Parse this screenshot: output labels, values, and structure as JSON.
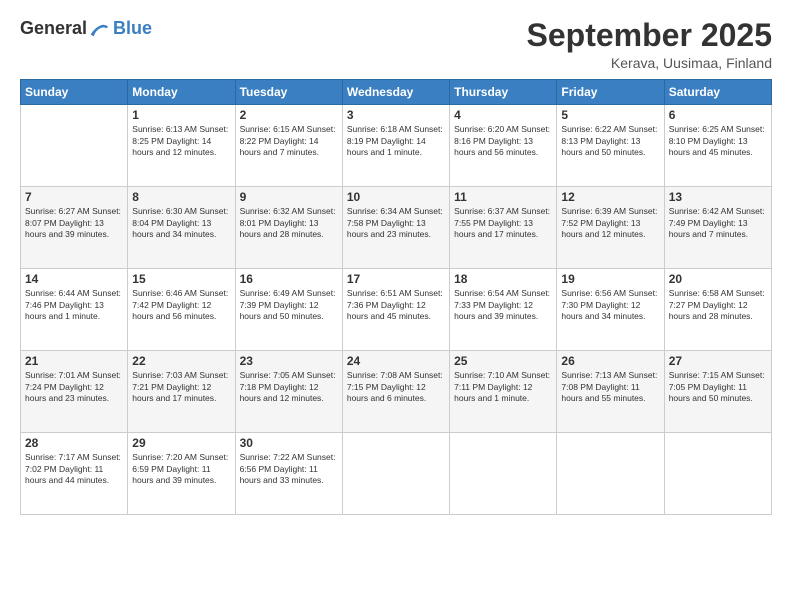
{
  "header": {
    "logo_general": "General",
    "logo_blue": "Blue",
    "title": "September 2025",
    "subtitle": "Kerava, Uusimaa, Finland"
  },
  "days_of_week": [
    "Sunday",
    "Monday",
    "Tuesday",
    "Wednesday",
    "Thursday",
    "Friday",
    "Saturday"
  ],
  "weeks": [
    [
      {
        "day": "",
        "info": ""
      },
      {
        "day": "1",
        "info": "Sunrise: 6:13 AM\nSunset: 8:25 PM\nDaylight: 14 hours\nand 12 minutes."
      },
      {
        "day": "2",
        "info": "Sunrise: 6:15 AM\nSunset: 8:22 PM\nDaylight: 14 hours\nand 7 minutes."
      },
      {
        "day": "3",
        "info": "Sunrise: 6:18 AM\nSunset: 8:19 PM\nDaylight: 14 hours\nand 1 minute."
      },
      {
        "day": "4",
        "info": "Sunrise: 6:20 AM\nSunset: 8:16 PM\nDaylight: 13 hours\nand 56 minutes."
      },
      {
        "day": "5",
        "info": "Sunrise: 6:22 AM\nSunset: 8:13 PM\nDaylight: 13 hours\nand 50 minutes."
      },
      {
        "day": "6",
        "info": "Sunrise: 6:25 AM\nSunset: 8:10 PM\nDaylight: 13 hours\nand 45 minutes."
      }
    ],
    [
      {
        "day": "7",
        "info": "Sunrise: 6:27 AM\nSunset: 8:07 PM\nDaylight: 13 hours\nand 39 minutes."
      },
      {
        "day": "8",
        "info": "Sunrise: 6:30 AM\nSunset: 8:04 PM\nDaylight: 13 hours\nand 34 minutes."
      },
      {
        "day": "9",
        "info": "Sunrise: 6:32 AM\nSunset: 8:01 PM\nDaylight: 13 hours\nand 28 minutes."
      },
      {
        "day": "10",
        "info": "Sunrise: 6:34 AM\nSunset: 7:58 PM\nDaylight: 13 hours\nand 23 minutes."
      },
      {
        "day": "11",
        "info": "Sunrise: 6:37 AM\nSunset: 7:55 PM\nDaylight: 13 hours\nand 17 minutes."
      },
      {
        "day": "12",
        "info": "Sunrise: 6:39 AM\nSunset: 7:52 PM\nDaylight: 13 hours\nand 12 minutes."
      },
      {
        "day": "13",
        "info": "Sunrise: 6:42 AM\nSunset: 7:49 PM\nDaylight: 13 hours\nand 7 minutes."
      }
    ],
    [
      {
        "day": "14",
        "info": "Sunrise: 6:44 AM\nSunset: 7:46 PM\nDaylight: 13 hours\nand 1 minute."
      },
      {
        "day": "15",
        "info": "Sunrise: 6:46 AM\nSunset: 7:42 PM\nDaylight: 12 hours\nand 56 minutes."
      },
      {
        "day": "16",
        "info": "Sunrise: 6:49 AM\nSunset: 7:39 PM\nDaylight: 12 hours\nand 50 minutes."
      },
      {
        "day": "17",
        "info": "Sunrise: 6:51 AM\nSunset: 7:36 PM\nDaylight: 12 hours\nand 45 minutes."
      },
      {
        "day": "18",
        "info": "Sunrise: 6:54 AM\nSunset: 7:33 PM\nDaylight: 12 hours\nand 39 minutes."
      },
      {
        "day": "19",
        "info": "Sunrise: 6:56 AM\nSunset: 7:30 PM\nDaylight: 12 hours\nand 34 minutes."
      },
      {
        "day": "20",
        "info": "Sunrise: 6:58 AM\nSunset: 7:27 PM\nDaylight: 12 hours\nand 28 minutes."
      }
    ],
    [
      {
        "day": "21",
        "info": "Sunrise: 7:01 AM\nSunset: 7:24 PM\nDaylight: 12 hours\nand 23 minutes."
      },
      {
        "day": "22",
        "info": "Sunrise: 7:03 AM\nSunset: 7:21 PM\nDaylight: 12 hours\nand 17 minutes."
      },
      {
        "day": "23",
        "info": "Sunrise: 7:05 AM\nSunset: 7:18 PM\nDaylight: 12 hours\nand 12 minutes."
      },
      {
        "day": "24",
        "info": "Sunrise: 7:08 AM\nSunset: 7:15 PM\nDaylight: 12 hours\nand 6 minutes."
      },
      {
        "day": "25",
        "info": "Sunrise: 7:10 AM\nSunset: 7:11 PM\nDaylight: 12 hours\nand 1 minute."
      },
      {
        "day": "26",
        "info": "Sunrise: 7:13 AM\nSunset: 7:08 PM\nDaylight: 11 hours\nand 55 minutes."
      },
      {
        "day": "27",
        "info": "Sunrise: 7:15 AM\nSunset: 7:05 PM\nDaylight: 11 hours\nand 50 minutes."
      }
    ],
    [
      {
        "day": "28",
        "info": "Sunrise: 7:17 AM\nSunset: 7:02 PM\nDaylight: 11 hours\nand 44 minutes."
      },
      {
        "day": "29",
        "info": "Sunrise: 7:20 AM\nSunset: 6:59 PM\nDaylight: 11 hours\nand 39 minutes."
      },
      {
        "day": "30",
        "info": "Sunrise: 7:22 AM\nSunset: 6:56 PM\nDaylight: 11 hours\nand 33 minutes."
      },
      {
        "day": "",
        "info": ""
      },
      {
        "day": "",
        "info": ""
      },
      {
        "day": "",
        "info": ""
      },
      {
        "day": "",
        "info": ""
      }
    ]
  ]
}
